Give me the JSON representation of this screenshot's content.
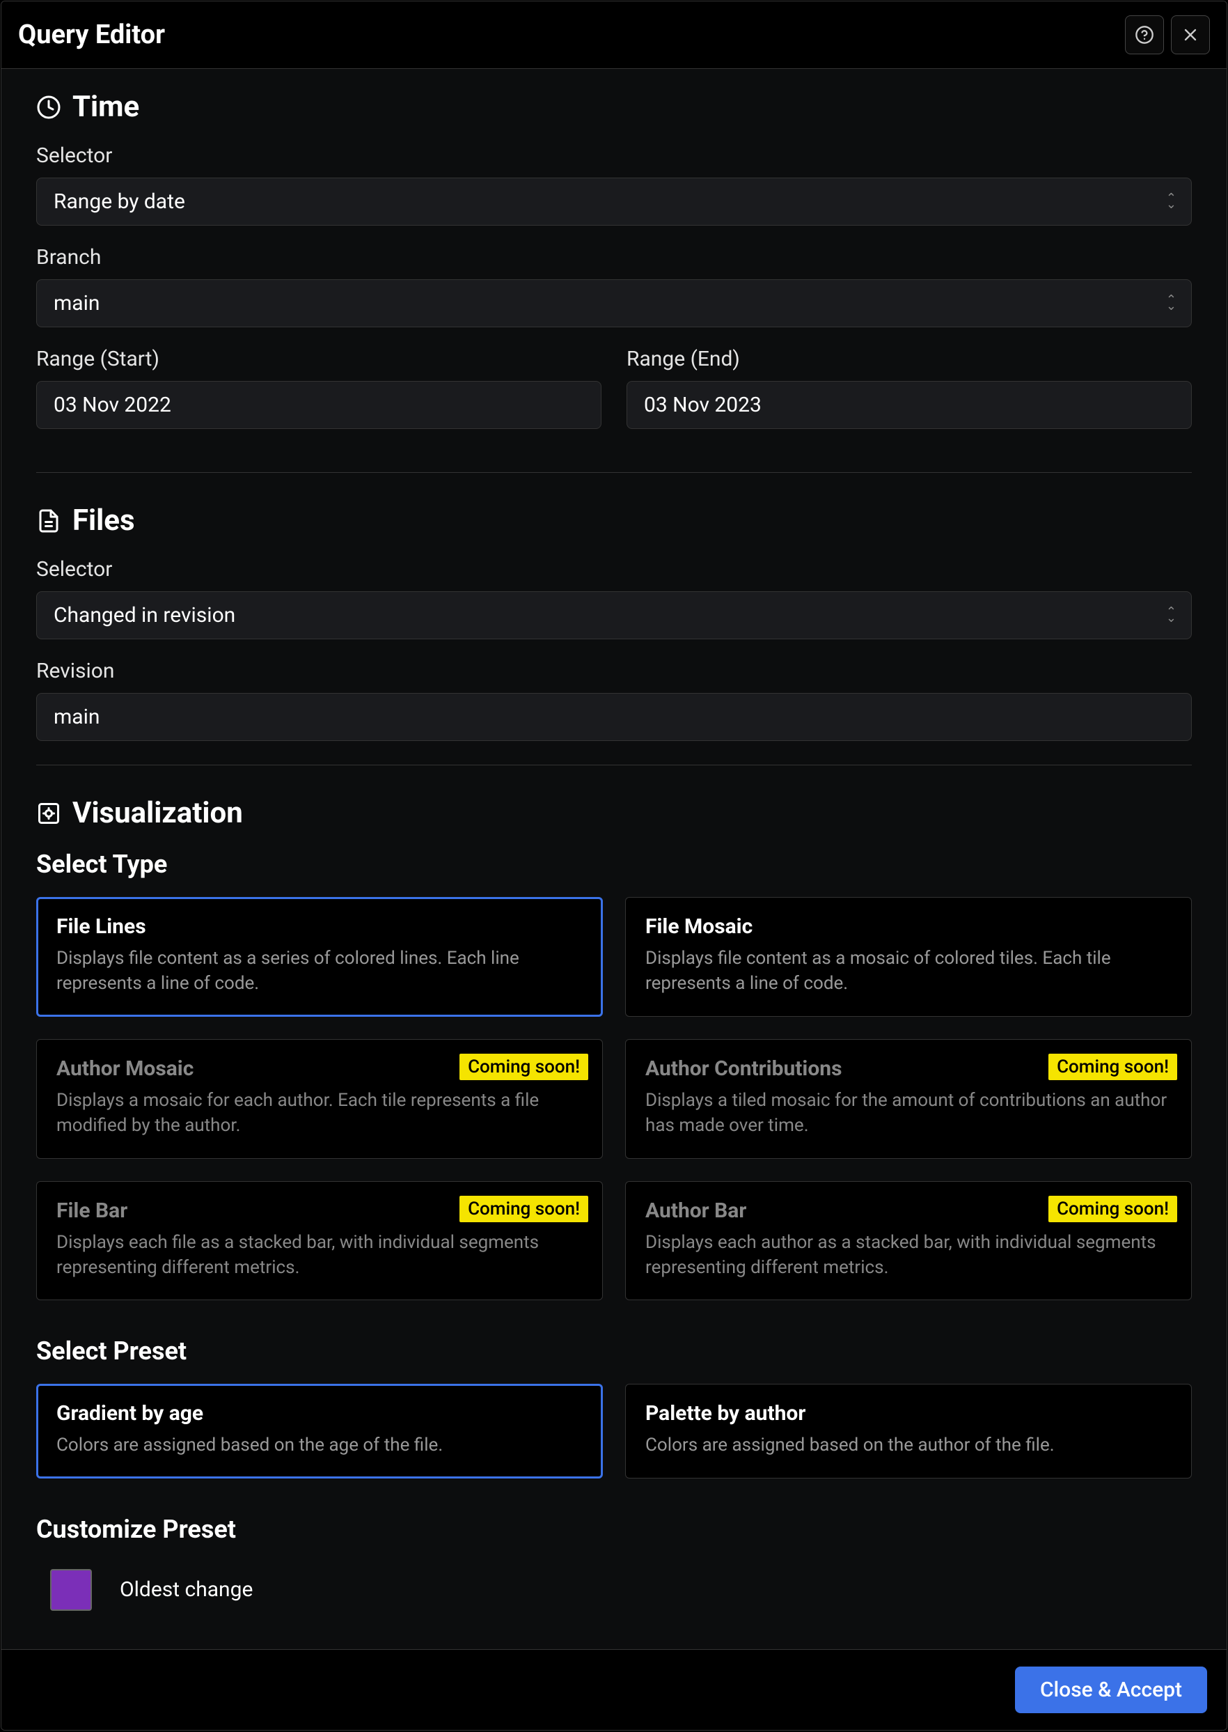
{
  "header": {
    "title": "Query Editor"
  },
  "time": {
    "heading": "Time",
    "selector_label": "Selector",
    "selector_value": "Range by date",
    "branch_label": "Branch",
    "branch_value": "main",
    "range_start_label": "Range (Start)",
    "range_start_value": "03 Nov 2022",
    "range_end_label": "Range (End)",
    "range_end_value": "03 Nov 2023"
  },
  "files": {
    "heading": "Files",
    "selector_label": "Selector",
    "selector_value": "Changed in revision",
    "revision_label": "Revision",
    "revision_value": "main"
  },
  "visualization": {
    "heading": "Visualization",
    "select_type_heading": "Select Type",
    "coming_soon": "Coming soon!",
    "types": [
      {
        "title": "File Lines",
        "desc": "Displays file content as a series of colored lines. Each line represents a line of code.",
        "selected": true,
        "disabled": false
      },
      {
        "title": "File Mosaic",
        "desc": "Displays file content as a mosaic of colored tiles. Each tile represents a line of code.",
        "selected": false,
        "disabled": false
      },
      {
        "title": "Author Mosaic",
        "desc": "Displays a mosaic for each author. Each tile represents a file modified by the author.",
        "selected": false,
        "disabled": true
      },
      {
        "title": "Author Contributions",
        "desc": "Displays a tiled mosaic for the amount of contributions an author has made over time.",
        "selected": false,
        "disabled": true
      },
      {
        "title": "File Bar",
        "desc": "Displays each file as a stacked bar, with individual segments representing different metrics.",
        "selected": false,
        "disabled": true
      },
      {
        "title": "Author Bar",
        "desc": "Displays each author as a stacked bar, with individual segments representing different metrics.",
        "selected": false,
        "disabled": true
      }
    ],
    "select_preset_heading": "Select Preset",
    "presets": [
      {
        "title": "Gradient by age",
        "desc": "Colors are assigned based on the age of the file.",
        "selected": true
      },
      {
        "title": "Palette by author",
        "desc": "Colors are assigned based on the author of the file.",
        "selected": false
      }
    ],
    "customize_heading": "Customize Preset",
    "swatches": [
      {
        "label": "Oldest change",
        "color": "#7b2fb8"
      }
    ]
  },
  "footer": {
    "accept_label": "Close & Accept"
  }
}
